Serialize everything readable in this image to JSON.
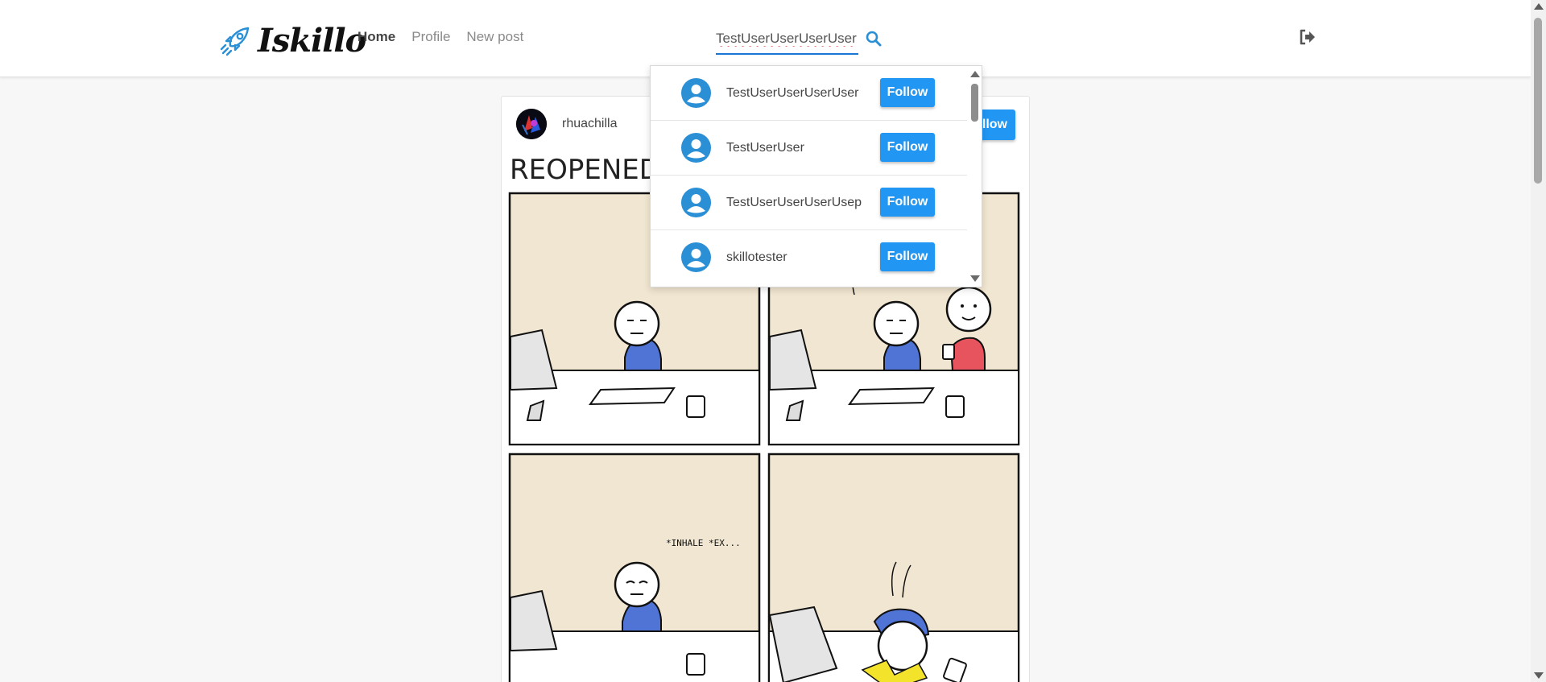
{
  "brand": {
    "name": "Iskillo",
    "accent": "#2196f3"
  },
  "nav": {
    "links": [
      {
        "label": "Home",
        "active": true
      },
      {
        "label": "Profile",
        "active": false
      },
      {
        "label": "New post",
        "active": false
      }
    ]
  },
  "search": {
    "value": "TestUserUserUserUser",
    "icon": "search-icon"
  },
  "header": {
    "logout_icon": "sign-out-icon"
  },
  "post": {
    "username": "rhuachilla",
    "follow_label": "Follow",
    "image": {
      "title": "REOPENED",
      "caption": "*INHALE *EX..."
    }
  },
  "dropdown": {
    "users": [
      {
        "name": "TestUserUserUserUser",
        "follow_label": "Follow"
      },
      {
        "name": "TestUserUser",
        "follow_label": "Follow"
      },
      {
        "name": "TestUserUserUserUsep",
        "follow_label": "Follow"
      },
      {
        "name": "skillotester",
        "follow_label": "Follow"
      }
    ]
  }
}
